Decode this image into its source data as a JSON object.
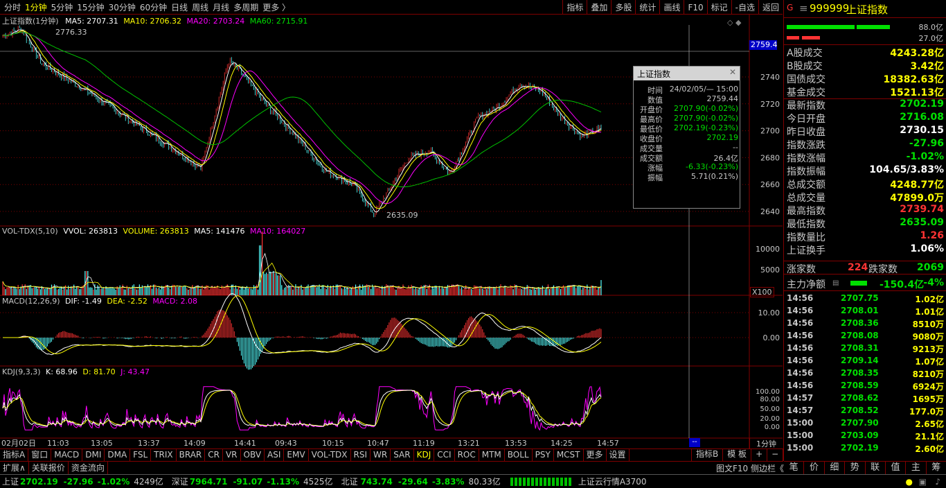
{
  "toolbar": {
    "periods": [
      "分时",
      "1分钟",
      "5分钟",
      "15分钟",
      "30分钟",
      "60分钟",
      "日线",
      "周线",
      "月线",
      "多周期",
      "更多 〉"
    ],
    "active_index": 1,
    "right_tools": [
      "指标",
      "叠加",
      "多股",
      "统计",
      "画线",
      "F10",
      "标记",
      "-自选",
      "返回"
    ]
  },
  "chart": {
    "main_legend": {
      "name": "上证指数(1分钟)",
      "ma5": "MA5: 2707.31",
      "ma10": "MA10: 2706.32",
      "ma20": "MA20: 2703.24",
      "ma60": "MA60: 2715.91"
    },
    "high_label": "2776.33",
    "low_label": "2635.09",
    "crosshair_price": "2759.4",
    "price_ticks": [
      "2740",
      "2720",
      "2700",
      "2680",
      "2660",
      "2640"
    ],
    "vol_legend": {
      "name": "VOL-TDX(5,10)",
      "vvol": "VVOL: 263813",
      "volume": "VOLUME: 263813",
      "ma5": "MA5: 141476",
      "ma10": "MA10: 164027"
    },
    "vol_ticks": [
      "10000",
      "5000"
    ],
    "vol_unit": "X100",
    "macd_legend": {
      "name": "MACD(12,26,9)",
      "dif": "DIF: -1.49",
      "dea": "DEA: -2.52",
      "macd": "MACD: 2.08"
    },
    "macd_ticks": [
      "10.00",
      "0.00"
    ],
    "kdj_legend": {
      "name": "KDJ(9,3,3)",
      "k": "K: 68.96",
      "d": "D: 81.70",
      "j": "J: 43.47"
    },
    "kdj_ticks": [
      "100.00",
      "80.00",
      "50.00",
      "20.00",
      "0.00"
    ],
    "time_labels": [
      "02月02日",
      "11:03",
      "13:05",
      "13:37",
      "14:09",
      "14:41",
      "09:43",
      "10:15",
      "10:47",
      "11:19",
      "13:21",
      "13:53",
      "14:25",
      "14:57"
    ],
    "time_marker": "--",
    "period_label": "1分钟"
  },
  "popup": {
    "title": "上证指数",
    "rows": [
      {
        "k": "时间",
        "v": "24/02/05/— 15:00",
        "c": "#c8c8c8"
      },
      {
        "k": "数值",
        "v": "2759.44",
        "c": "#c8c8c8"
      },
      {
        "k": "开盘价",
        "v": "2707.90(-0.02%)",
        "c": "#00e000"
      },
      {
        "k": "最高价",
        "v": "2707.90(-0.02%)",
        "c": "#00e000"
      },
      {
        "k": "最低价",
        "v": "2702.19(-0.23%)",
        "c": "#00e000"
      },
      {
        "k": "收盘价",
        "v": "2702.19",
        "c": "#00e000"
      },
      {
        "k": "成交量",
        "v": "--",
        "c": "#c8c8c8"
      },
      {
        "k": "成交额",
        "v": "26.4亿",
        "c": "#c8c8c8"
      },
      {
        "k": "涨幅",
        "v": "-6.33(-0.23%)",
        "c": "#00e000"
      },
      {
        "k": "振幅",
        "v": "5.71(0.21%)",
        "c": "#c8c8c8"
      }
    ]
  },
  "right_panel": {
    "code": "999999",
    "name": "上证指数",
    "bar_top": "88.0亿",
    "bar_bot": "27.0亿",
    "stats": [
      {
        "l": "A股成交",
        "v": "4243.28亿",
        "c": "#ffff00"
      },
      {
        "l": "B股成交",
        "v": "3.42亿",
        "c": "#ffff00"
      },
      {
        "l": "国债成交",
        "v": "18382.63亿",
        "c": "#ffff00"
      },
      {
        "l": "基金成交",
        "v": "1521.13亿",
        "c": "#ffff00"
      },
      {
        "l": "最新指数",
        "v": "2702.19",
        "c": "#00e000"
      },
      {
        "l": "今日开盘",
        "v": "2716.08",
        "c": "#00e000"
      },
      {
        "l": "昨日收盘",
        "v": "2730.15",
        "c": "#ffffff"
      },
      {
        "l": "指数涨跌",
        "v": "-27.96",
        "c": "#00e000"
      },
      {
        "l": "指数涨幅",
        "v": "-1.02%",
        "c": "#00e000"
      },
      {
        "l": "指数振幅",
        "v": "104.65/3.83%",
        "c": "#ffffff"
      },
      {
        "l": "总成交额",
        "v": "4248.77亿",
        "c": "#ffff00"
      },
      {
        "l": "总成交量",
        "v": "47899.0万",
        "c": "#ffff00"
      },
      {
        "l": "最高指数",
        "v": "2739.74",
        "c": "#ff3333"
      },
      {
        "l": "最低指数",
        "v": "2635.09",
        "c": "#00e000"
      },
      {
        "l": "指数量比",
        "v": "1.26",
        "c": "#ff3333"
      },
      {
        "l": "上证换手",
        "v": "1.06%",
        "c": "#ffffff"
      }
    ],
    "up_label": "涨家数",
    "up": "224",
    "down_label": "跌家数",
    "down": "2069",
    "main_flow_label": "主力净额",
    "main_flow": "-150.4亿",
    "main_flow_pct": "-4%",
    "ticks": [
      {
        "t": "14:56",
        "p": "2707.75",
        "v": "1.02亿"
      },
      {
        "t": "14:56",
        "p": "2708.01",
        "v": "1.01亿"
      },
      {
        "t": "14:56",
        "p": "2708.36",
        "v": "8510万"
      },
      {
        "t": "14:56",
        "p": "2708.08",
        "v": "9080万"
      },
      {
        "t": "14:56",
        "p": "2708.31",
        "v": "9213万"
      },
      {
        "t": "14:56",
        "p": "2709.14",
        "v": "1.07亿"
      },
      {
        "t": "14:56",
        "p": "2708.35",
        "v": "8210万"
      },
      {
        "t": "14:56",
        "p": "2708.59",
        "v": "6924万"
      },
      {
        "t": "14:57",
        "p": "2708.62",
        "v": "1695万"
      },
      {
        "t": "14:57",
        "p": "2708.52",
        "v": "177.0万"
      },
      {
        "t": "15:00",
        "p": "2707.90",
        "v": "2.65亿"
      },
      {
        "t": "15:00",
        "p": "2703.09",
        "v": "21.1亿"
      },
      {
        "t": "15:00",
        "p": "2702.19",
        "v": "2.60亿"
      }
    ],
    "bottom_tabs": [
      "笔",
      "价",
      "细",
      "势",
      "联",
      "值",
      "主",
      "筹"
    ]
  },
  "indicator_tabs": [
    "指标A",
    "窗口",
    "MACD",
    "DMI",
    "DMA",
    "FSL",
    "TRIX",
    "BRAR",
    "CR",
    "VR",
    "OBV",
    "ASI",
    "EMV",
    "VOL-TDX",
    "RSI",
    "WR",
    "SAR",
    "KDJ",
    "CCI",
    "ROC",
    "MTM",
    "BOLL",
    "PSY",
    "MCST",
    "更多",
    "设置"
  ],
  "indicator_right": [
    "指标B",
    "模 板",
    "+",
    "−"
  ],
  "sub_tabs": [
    "扩展∧",
    "关联报价",
    "资金流向"
  ],
  "side_tabs": "图文F10 侧边栏《",
  "status": {
    "sh_name": "上证",
    "sh_val": "2702.19",
    "sh_chg": "-27.96",
    "sh_pct": "-1.02%",
    "sh_amt": "4249亿",
    "sz_name": "深证",
    "sz_val": "7964.71",
    "sz_chg": "-91.07",
    "sz_pct": "-1.13%",
    "sz_amt": "4525亿",
    "bz_name": "北证",
    "bz_val": "743.74",
    "bz_chg": "-29.64",
    "bz_pct": "-3.83%",
    "bz_amt": "80.33亿",
    "cloud": "上证云行情A3700"
  }
}
